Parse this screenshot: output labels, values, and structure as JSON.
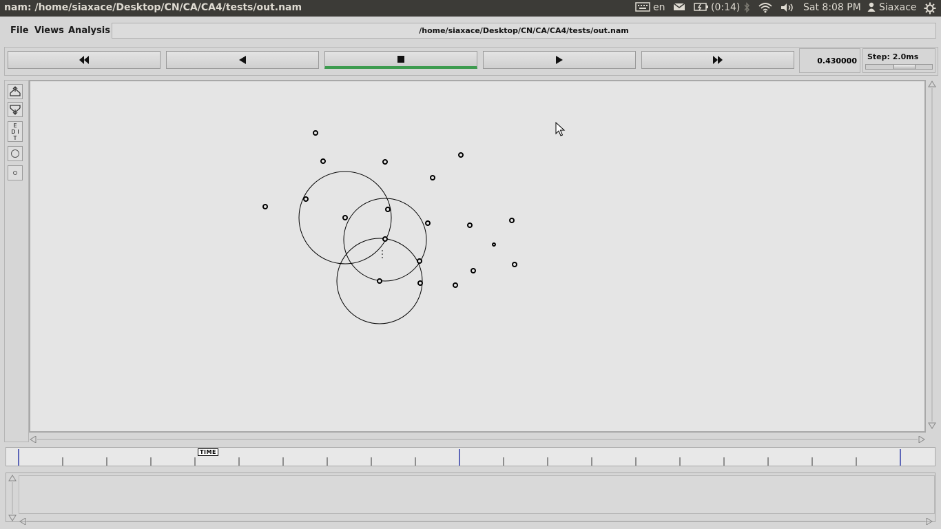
{
  "window": {
    "title": "nam: /home/siaxace/Desktop/CN/CA/CA4/tests/out.nam"
  },
  "system_tray": {
    "keyboard_layout": "en",
    "battery": "(0:14)",
    "clock": "Sat  8:08 PM",
    "user": "Siaxace"
  },
  "menu": {
    "file": "File",
    "views": "Views",
    "analysis": "Analysis"
  },
  "trace_file": "/home/siaxace/Desktop/CN/CA/CA4/tests/out.nam",
  "playback": {
    "buttons": [
      "fast-rewind",
      "rewind",
      "stop",
      "play",
      "fast-forward"
    ],
    "active": "stop",
    "active_color": "#3d9b4f",
    "current_time": "0.430000",
    "step_label": "Step: 2.0ms"
  },
  "tools": {
    "edit_label": "EDIT"
  },
  "timeline": {
    "marker_label": "TIME"
  }
}
